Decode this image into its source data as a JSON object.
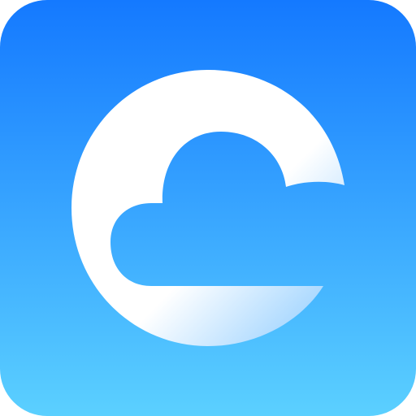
{
  "icon": {
    "name": "cloud-browser-app-icon",
    "colors": {
      "tile_top": "#1479ff",
      "tile_bottom": "#5bd0ff",
      "glyph_light": "#ffffff",
      "glyph_shade": "#a9d8ff"
    }
  }
}
